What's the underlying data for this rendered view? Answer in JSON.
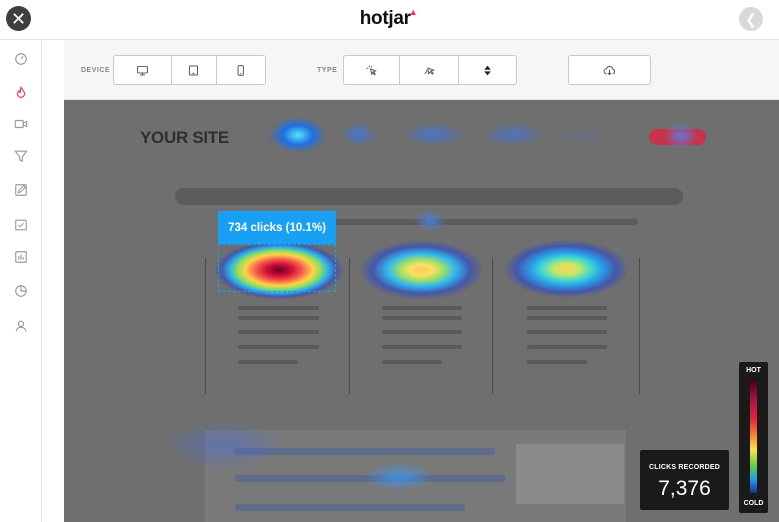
{
  "topbar": {
    "logo": "hotjar"
  },
  "sidebar": {
    "items": [
      {
        "icon": "dashboard-icon",
        "active": false
      },
      {
        "icon": "heatmap-flame-icon",
        "active": true
      },
      {
        "icon": "recording-camera-icon",
        "active": false
      },
      {
        "icon": "funnel-icon",
        "active": false
      },
      {
        "icon": "form-edit-icon",
        "active": false
      },
      {
        "icon": "poll-icon",
        "active": false
      },
      {
        "icon": "bar-chart-icon",
        "active": false
      },
      {
        "icon": "pie-chart-icon",
        "active": false
      },
      {
        "icon": "user-icon",
        "active": false
      }
    ]
  },
  "toolbar": {
    "device_label": "DEVICE",
    "type_label": "TYPE",
    "device_options": [
      "desktop-icon",
      "tablet-icon",
      "phone-icon"
    ],
    "type_options": [
      "click-icon",
      "move-icon",
      "scroll-icon"
    ],
    "download_icon": "cloud-download-icon"
  },
  "heatmap": {
    "site_logo": "YOUR SITE",
    "tooltip": "734 clicks (10.1%)"
  },
  "legend": {
    "hot": "HOT",
    "cold": "COLD"
  },
  "clicks": {
    "label": "CLICKS RECORDED",
    "value": "7,376"
  },
  "colors": {
    "accent": "#f4364c",
    "tooltip": "#18a0f5",
    "overlay": "#6f6f6f"
  }
}
